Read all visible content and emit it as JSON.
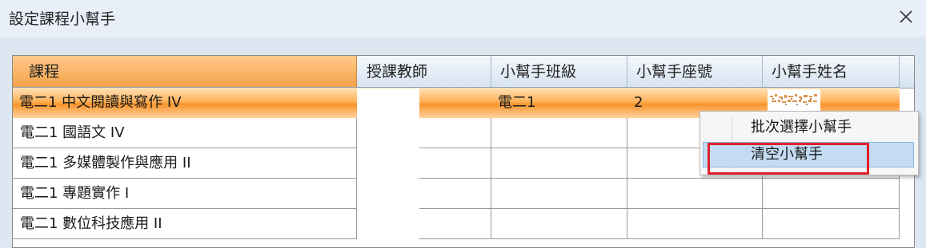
{
  "window": {
    "title": "設定課程小幫手"
  },
  "grid": {
    "columns": [
      "課程",
      "授課教師",
      "小幫手班級",
      "小幫手座號",
      "小幫手姓名"
    ],
    "rows": [
      {
        "course": "電二1 中文閱讀與寫作 IV",
        "teacher": "",
        "helper_class": "電二1",
        "helper_seat": "2",
        "helper_name": ""
      },
      {
        "course": "電二1 國語文 IV",
        "teacher": "",
        "helper_class": "",
        "helper_seat": "",
        "helper_name": ""
      },
      {
        "course": "電二1 多媒體製作與應用 II",
        "teacher": "",
        "helper_class": "",
        "helper_seat": "",
        "helper_name": ""
      },
      {
        "course": "電二1 專題實作 I",
        "teacher": "",
        "helper_class": "",
        "helper_seat": "",
        "helper_name": ""
      },
      {
        "course": "電二1 數位科技應用 II",
        "teacher": "",
        "helper_class": "",
        "helper_seat": "",
        "helper_name": ""
      }
    ]
  },
  "context_menu": {
    "items": [
      {
        "label": "批次選擇小幫手"
      },
      {
        "label": "清空小幫手"
      }
    ]
  },
  "colors": {
    "selection": "#f8952c",
    "highlight_box": "#e0202a",
    "menu_hover": "#c3dcf3"
  },
  "icons": {
    "close": "close-icon"
  }
}
